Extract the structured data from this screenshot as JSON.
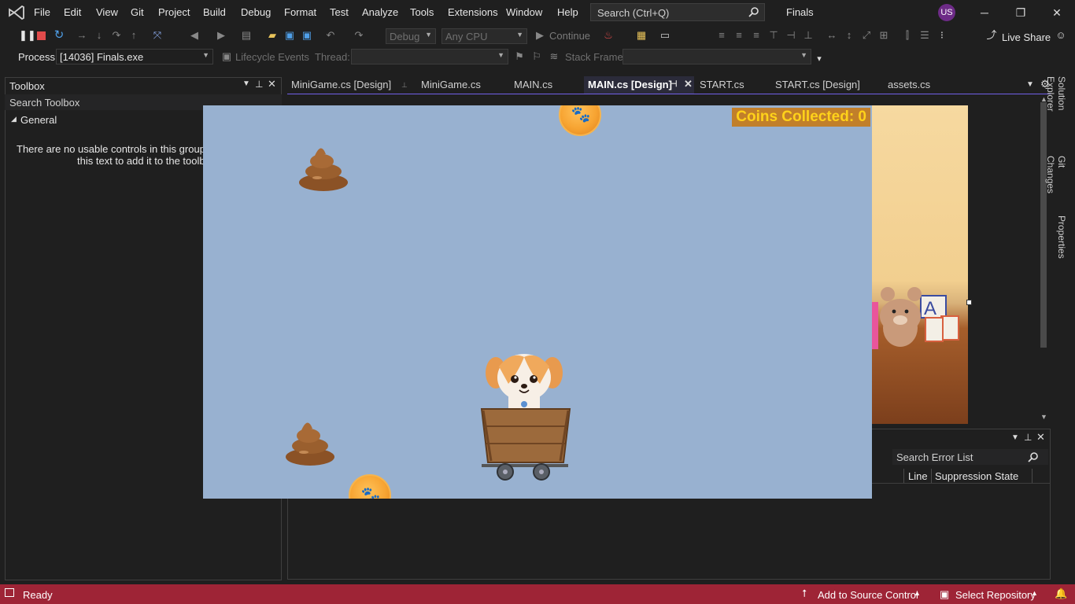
{
  "menu": {
    "items": [
      "File",
      "Edit",
      "View",
      "Git",
      "Project",
      "Build",
      "Debug",
      "Format",
      "Test",
      "Analyze",
      "Tools",
      "Extensions",
      "Window",
      "Help"
    ],
    "search_placeholder": "Search (Ctrl+Q)",
    "solution_name": "Finals",
    "user_initials": "US"
  },
  "toolbar": {
    "config": "Debug",
    "platform": "Any CPU",
    "continue_label": "Continue",
    "live_share_label": "Live Share"
  },
  "process_bar": {
    "process_label": "Process:",
    "process_value": "[14036] Finals.exe",
    "lifecycle_label": "Lifecycle Events",
    "thread_label": "Thread:",
    "stack_frame_label": "Stack Frame:"
  },
  "toolbox": {
    "title": "Toolbox",
    "search_placeholder": "Search Toolbox",
    "group": "General",
    "empty_line1": "There are no usable controls in this group. Dr",
    "empty_line2": "this text to add it to the toolbo"
  },
  "tabs": [
    {
      "label": "MiniGame.cs [Design]"
    },
    {
      "label": "MiniGame.cs"
    },
    {
      "label": "MAIN.cs"
    },
    {
      "label": "MAIN.cs [Design]",
      "active": true
    },
    {
      "label": "START.cs"
    },
    {
      "label": "START.cs [Design]"
    },
    {
      "label": "assets.cs"
    }
  ],
  "right_rail": [
    "Solution Explorer",
    "Git Changes",
    "Properties"
  ],
  "error_list": {
    "search_placeholder": "Search Error List",
    "columns": [
      "Line",
      "Suppression State"
    ]
  },
  "game": {
    "coins_label": "Coins Collected: 0"
  },
  "status": {
    "ready": "Ready",
    "add_source_control": "Add to Source Control",
    "select_repository": "Select Repository"
  },
  "colors": {
    "accent": "#7160e8",
    "status_bar": "#9e2436",
    "game_background": "#98b1d0",
    "coins_text": "#ffd21a",
    "coins_bg": "#c17f2a"
  }
}
